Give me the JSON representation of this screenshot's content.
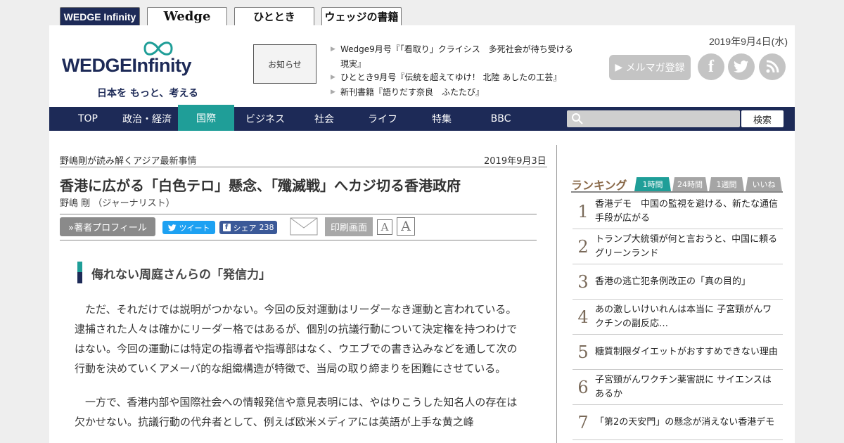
{
  "site_tabs": [
    "WEDGE Infinity",
    "Wedge",
    "ひととき",
    "ウェッジの書籍"
  ],
  "header": {
    "logo_main": "WEDGE",
    "logo_accent": "Infinity",
    "logo_tagline": "日本を もっと、考える",
    "notice_label": "お知らせ",
    "news": [
      "Wedge9月号『「看取り」クライシス　多死社会が待ち受ける現実』",
      "ひととき9月号『伝統を超えてゆけ！ 北陸 あしたの工芸』",
      "新刊書籍『語りだす奈良　ふたたび』"
    ],
    "date": "2019年9月4日(水)",
    "mail_button": "メルマガ登録",
    "social": [
      "facebook-icon",
      "twitter-icon",
      "rss-icon"
    ]
  },
  "nav": {
    "items": [
      "TOP",
      "政治・経済",
      "国際",
      "ビジネス",
      "社会",
      "ライフ",
      "特集",
      "BBC"
    ],
    "active": "国際",
    "search_placeholder": "",
    "search_button": "検索"
  },
  "article": {
    "series": "野嶋剛が読み解くアジア最新事情",
    "date": "2019年9月3日",
    "title": "香港に広がる「白色テロ」懸念、「殲滅戦」へカジ切る香港政府",
    "author": "野嶋 剛 （ジャーナリスト）",
    "profile_button": "»著者プロフィール",
    "tweet_label": "ツイート",
    "share_label": "シェア",
    "share_count": "238",
    "print_button": "印刷画面",
    "font_small": "A",
    "font_large": "A",
    "heading": "侮れない周庭さんらの「発信力」",
    "paragraphs": [
      "ただ、それだけでは説明がつかない。今回の反対運動はリーダーなき運動と言われている。逮捕された人々は確かにリーダー格ではあるが、個別の抗議行動について決定権を持つわけではない。今回の運動には特定の指導者や指導部はなく、ウエブでの書き込みなどを通して次の行動を決めていくアメーバ的な組織構造が特徴で、当局の取り締まりを困難にさせている。",
      "一方で、香港内部や国際社会への情報発信や意見表明には、やはりこうした知名人の存在は欠かせない。抗議行動の代弁者として、例えば欧米メディアには英語が上手な黄之峰"
    ]
  },
  "ranking": {
    "heading": "ランキング",
    "tabs": [
      "1時間",
      "24時間",
      "1週間",
      "いいね"
    ],
    "active_tab": "1時間",
    "items": [
      {
        "num": "1",
        "title": "香港デモ　中国の監視を避ける、新たな通信手段が広がる"
      },
      {
        "num": "2",
        "title": "トランプ大統領が何と言おうと、中国に頼るグリーンランド"
      },
      {
        "num": "3",
        "title": "香港の逃亡犯条例改正の「真の目的」"
      },
      {
        "num": "4",
        "title": "あの激しいけいれんは本当に 子宮頸がんワクチンの副反応…"
      },
      {
        "num": "5",
        "title": "糖質制限ダイエットがおすすめできない理由"
      },
      {
        "num": "6",
        "title": "子宮頸がんワクチン薬害説に サイエンスはあるか"
      },
      {
        "num": "7",
        "title": "「第2の天安門」の懸念が消えない香港デモ"
      }
    ]
  },
  "colors": {
    "navy": "#1d2a57",
    "teal": "#1f9e98",
    "twitter": "#1da1f2",
    "facebook": "#3b5998"
  }
}
